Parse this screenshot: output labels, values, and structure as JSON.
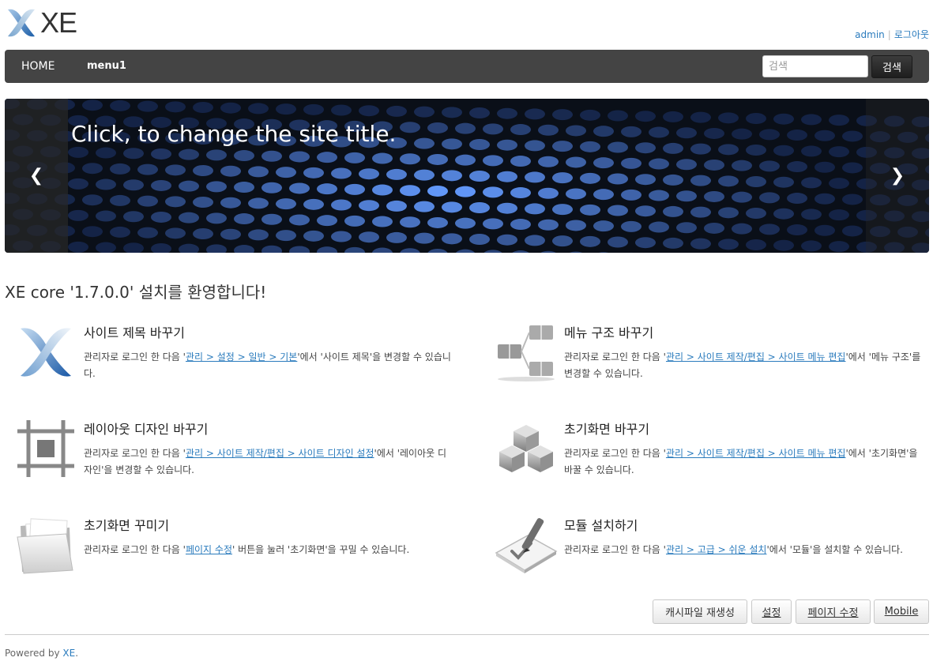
{
  "header": {
    "logo_text": "XE",
    "user": "admin",
    "logout": "로그아웃"
  },
  "nav": {
    "items": [
      "HOME",
      "menu1"
    ],
    "search_placeholder": "검색",
    "search_button": "검색"
  },
  "banner": {
    "title": "Click, to change the site title.",
    "prev": "❮",
    "next": "❯"
  },
  "welcome": "XE core '1.7.0.0' 설치를 환영합니다!",
  "features": [
    {
      "icon": "xe-logo-icon",
      "title": "사이트 제목 바꾸기",
      "pre": "관리자로 로그인 한 다음 '",
      "link": "관리 > 설정 > 일반 > 기본",
      "post": "'에서 '사이트 제목'을 변경할 수 있습니다."
    },
    {
      "icon": "menu-structure-icon",
      "title": "메뉴 구조 바꾸기",
      "pre": "관리자로 로그인 한 다음 '",
      "link": "관리 > 사이트 제작/편집 > 사이트 메뉴 편집",
      "post": "'에서 '메뉴 구조'를 변경할 수 있습니다."
    },
    {
      "icon": "layout-design-icon",
      "title": "레이아웃 디자인 바꾸기",
      "pre": "관리자로 로그인 한 다음 '",
      "link": "관리 > 사이트 제작/편집 > 사이트 디자인 설정",
      "post": "'에서 '레이아웃 디자인'을 변경할 수 있습니다."
    },
    {
      "icon": "cubes-icon",
      "title": "초기화면 바꾸기",
      "pre": "관리자로 로그인 한 다음 '",
      "link": "관리 > 사이트 제작/편집 > 사이트 메뉴 편집",
      "post": "'에서 '초기화면'을 바꿀 수 있습니다."
    },
    {
      "icon": "folder-icon",
      "title": "초기화면 꾸미기",
      "pre": "관리자로 로그인 한 다음 '",
      "link": "페이지 수정",
      "post": "' 버튼을 눌러 '초기화면'을 꾸밀 수 있습니다."
    },
    {
      "icon": "module-install-icon",
      "title": "모듈 설치하기",
      "pre": "관리자로 로그인 한 다음 '",
      "link": "관리 > 고급 > 쉬운 설치",
      "post": "'에서 '모듈'을 설치할 수 있습니다."
    }
  ],
  "buttons": {
    "cache": "캐시파일 재생성",
    "settings": "설정",
    "page_edit": "페이지 수정",
    "mobile": "Mobile"
  },
  "footer": {
    "text": "Powered by ",
    "link": "XE",
    "end": "."
  }
}
